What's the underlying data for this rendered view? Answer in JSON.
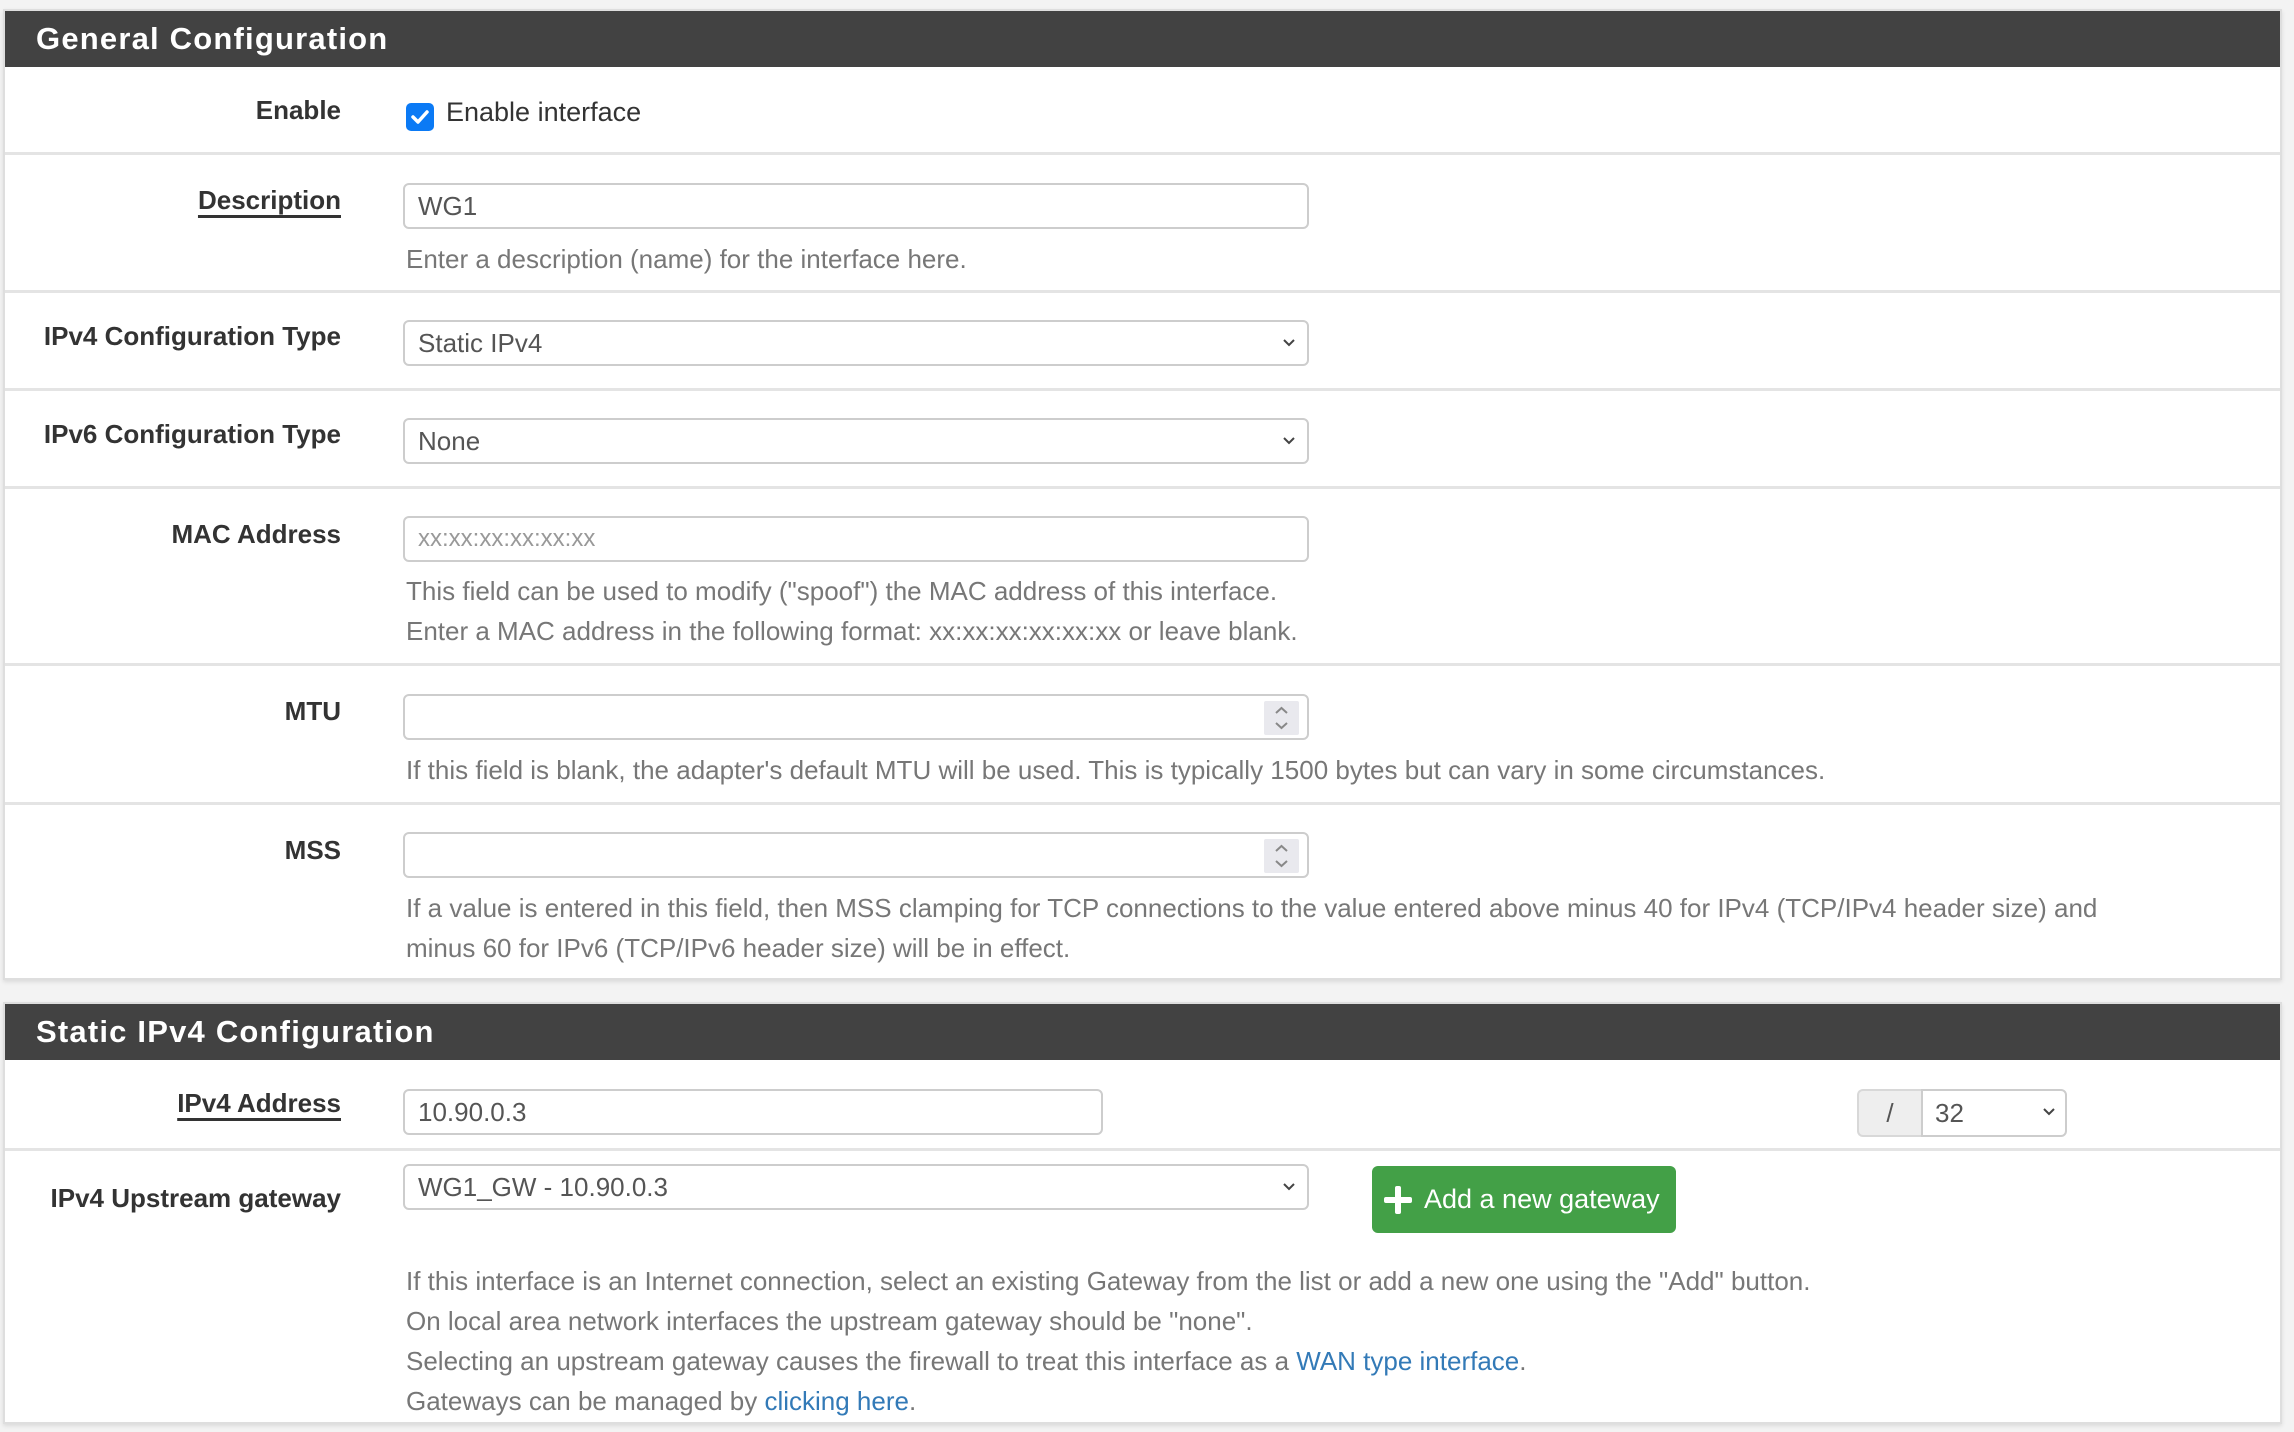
{
  "general": {
    "title": "General Configuration",
    "enable": {
      "label": "Enable",
      "checkbox_label": "Enable interface",
      "checked": true
    },
    "description": {
      "label": "Description",
      "value": "WG1",
      "help": "Enter a description (name) for the interface here."
    },
    "ipv4_type": {
      "label": "IPv4 Configuration Type",
      "value": "Static IPv4"
    },
    "ipv6_type": {
      "label": "IPv6 Configuration Type",
      "value": "None"
    },
    "mac": {
      "label": "MAC Address",
      "placeholder": "xx:xx:xx:xx:xx:xx",
      "help_lines": [
        "This field can be used to modify (\"spoof\") the MAC address of this interface.",
        "Enter a MAC address in the following format: xx:xx:xx:xx:xx:xx or leave blank."
      ]
    },
    "mtu": {
      "label": "MTU",
      "value": "",
      "help": "If this field is blank, the adapter's default MTU will be used. This is typically 1500 bytes but can vary in some circumstances."
    },
    "mss": {
      "label": "MSS",
      "value": "",
      "help_lines": [
        "If a value is entered in this field, then MSS clamping for TCP connections to the value entered above minus 40 for IPv4 (TCP/IPv4 header size) and",
        "minus 60 for IPv6 (TCP/IPv6 header size) will be in effect."
      ]
    }
  },
  "static_ipv4": {
    "title": "Static IPv4 Configuration",
    "address": {
      "label": "IPv4 Address",
      "value": "10.90.0.3",
      "separator": "/",
      "cidr": "32"
    },
    "gateway": {
      "label": "IPv4 Upstream gateway",
      "value": "WG1_GW - 10.90.0.3",
      "add_button": "Add a new gateway",
      "help": {
        "line1": "If this interface is an Internet connection, select an existing Gateway from the list or add a new one using the \"Add\" button.",
        "line2": "On local area network interfaces the upstream gateway should be \"none\".",
        "line3_prefix": "Selecting an upstream gateway causes the firewall to treat this interface as a ",
        "line3_link": "WAN type interface",
        "line3_suffix": ".",
        "line4_prefix": "Gateways can be managed by ",
        "line4_link": "clicking here",
        "line4_suffix": "."
      }
    }
  },
  "colors": {
    "heading_bg": "#424242",
    "accent_green": "#43a047",
    "link": "#337ab7",
    "checkbox": "#0b7af5"
  }
}
